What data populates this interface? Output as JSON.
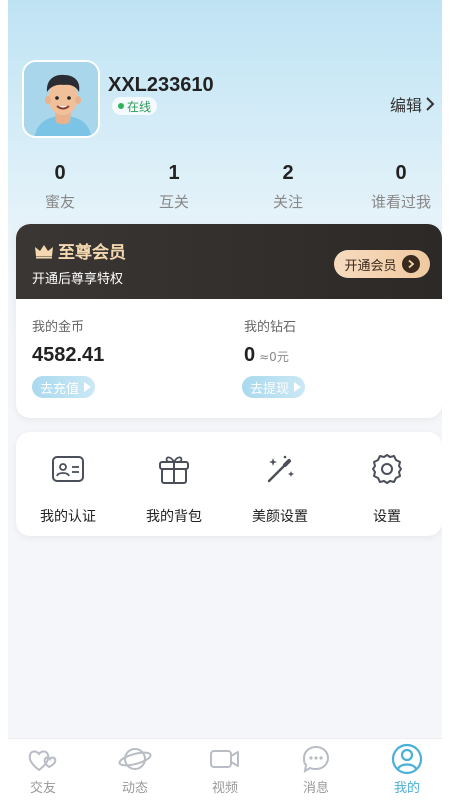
{
  "profile": {
    "username": "XXL233610",
    "status": "在线",
    "edit_label": "编辑"
  },
  "stats": [
    {
      "value": "0",
      "label": "蜜友"
    },
    {
      "value": "1",
      "label": "互关"
    },
    {
      "value": "2",
      "label": "关注"
    },
    {
      "value": "0",
      "label": "谁看过我"
    }
  ],
  "vip": {
    "title": "至尊会员",
    "subtitle": "开通后尊享特权",
    "button_label": "开通会员"
  },
  "wallet": {
    "coins_label": "我的金币",
    "coins_value": "4582.41",
    "recharge_label": "去充值",
    "diamonds_label": "我的钻石",
    "diamonds_value": "0",
    "diamonds_approx": "≈0元",
    "withdraw_label": "去提现"
  },
  "menu": [
    {
      "label": "我的认证",
      "icon": "id-card-icon"
    },
    {
      "label": "我的背包",
      "icon": "gift-icon"
    },
    {
      "label": "美颜设置",
      "icon": "magic-wand-icon"
    },
    {
      "label": "设置",
      "icon": "gear-icon"
    }
  ],
  "nav": [
    {
      "label": "交友",
      "icon": "hearts-icon"
    },
    {
      "label": "动态",
      "icon": "planet-icon"
    },
    {
      "label": "视频",
      "icon": "video-icon"
    },
    {
      "label": "消息",
      "icon": "chat-bubble-icon"
    },
    {
      "label": "我的",
      "icon": "profile-icon",
      "active": true
    }
  ],
  "colors": {
    "accent": "#4ab0d8",
    "vip_bg": "#2c2927",
    "vip_gold": "#f4d9b0",
    "online_green": "#2fb35a"
  }
}
